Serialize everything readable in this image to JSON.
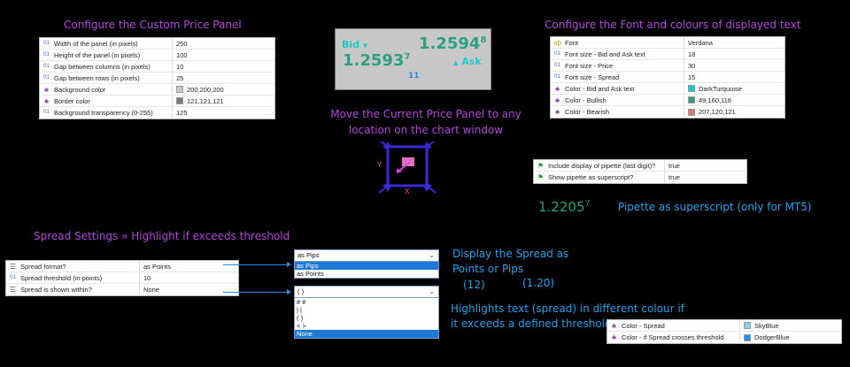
{
  "custom_panel": {
    "heading": "Configure the Custom Price Panel",
    "rows": [
      {
        "icon": "01",
        "label": "Width of the panel (in pixels)",
        "value": "250"
      },
      {
        "icon": "01",
        "label": "Height of the panel (in pixels)",
        "value": "100"
      },
      {
        "icon": "01",
        "label": "Gap between columns (in pixels)",
        "value": "10"
      },
      {
        "icon": "01",
        "label": "Gap between rows (in pixels)",
        "value": "25"
      },
      {
        "icon": "palette",
        "label": "Background color",
        "value": "200,200,200",
        "swatch": "#c8c8c8"
      },
      {
        "icon": "palette",
        "label": "Border color",
        "value": "121,121,121",
        "swatch": "#797979"
      },
      {
        "icon": "01",
        "label": "Background transparency (0-255)",
        "value": "125"
      }
    ]
  },
  "price_panel": {
    "bid_label": "Bid",
    "bid_arrow": "▼",
    "ask_label": "Ask",
    "ask_arrow": "▲",
    "bid_price": "1.2593",
    "bid_pipette": "7",
    "ask_price": "1.2594",
    "ask_pipette": "8",
    "spread": "11",
    "bid_color": "#2e9e80",
    "ask_color": "#2e9e80",
    "label_color": "#20c8c8"
  },
  "move_text": {
    "line1": "Move the Current Price Panel to any",
    "line2": "location on the chart window"
  },
  "move_widget": {
    "y_label": "Y",
    "x_label": "X"
  },
  "font_panel": {
    "heading": "Configure the Font and colours of displayed text",
    "rows": [
      {
        "icon": "font",
        "label": "Font",
        "value": "Verdana"
      },
      {
        "icon": "01",
        "label": "Font size - Bid and Ask text",
        "value": "18"
      },
      {
        "icon": "01",
        "label": "Font size - Price",
        "value": "30"
      },
      {
        "icon": "01",
        "label": "Font size - Spread",
        "value": "15"
      },
      {
        "icon": "palette",
        "label": "Color - Bid and Ask text",
        "value": "DarkTurquoise",
        "swatch": "#00ced1"
      },
      {
        "icon": "palette",
        "label": "Color - Bullish",
        "value": "49,160,116",
        "swatch": "#31a074"
      },
      {
        "icon": "palette",
        "label": "Color - Bearish",
        "value": "207,120,121",
        "swatch": "#cf7879"
      }
    ]
  },
  "pipette_panel": {
    "rows": [
      {
        "icon": "flag",
        "label": "Include display of pipette (last digit)?",
        "value": "true"
      },
      {
        "icon": "flag",
        "label": "Show pipette as superscript?",
        "value": "true"
      }
    ],
    "example_price": "1.2205",
    "example_pipette": "7",
    "caption": "Pipette as superscript (only for MT5)"
  },
  "spread_settings": {
    "heading": "Spread Settings » Highlight if exceeds threshold",
    "rows": [
      {
        "icon": "list",
        "label": "Spread format?",
        "value": "as Points"
      },
      {
        "icon": "01",
        "label": "Spread threshold (in points)",
        "value": "10"
      },
      {
        "icon": "list",
        "label": "Spread is shown within?",
        "value": "None"
      }
    ]
  },
  "format_dropdown": {
    "selected": "as Pips",
    "options": [
      "as Pips",
      "as Points"
    ],
    "highlighted": 0
  },
  "within_dropdown": {
    "selected": "( )",
    "options": [
      "# #",
      "| |",
      "( )",
      "< >",
      "None"
    ],
    "highlighted": 4
  },
  "display_note": {
    "line1": "Display the Spread as",
    "line2": "Points or Pips",
    "example_points": "(12)",
    "example_pips": "(1.20)"
  },
  "highlight_note": {
    "line1": "Highlights text (spread) in different colour if",
    "line2": "it exceeds a defined threshold"
  },
  "spread_color_panel": {
    "rows": [
      {
        "icon": "palette",
        "label": "Color - Spread",
        "value": "SkyBlue",
        "swatch": "#87ceeb"
      },
      {
        "icon": "palette",
        "label": "Color - if Spread crosses threshold",
        "value": "DodgerBlue",
        "swatch": "#1e90ff"
      }
    ]
  }
}
